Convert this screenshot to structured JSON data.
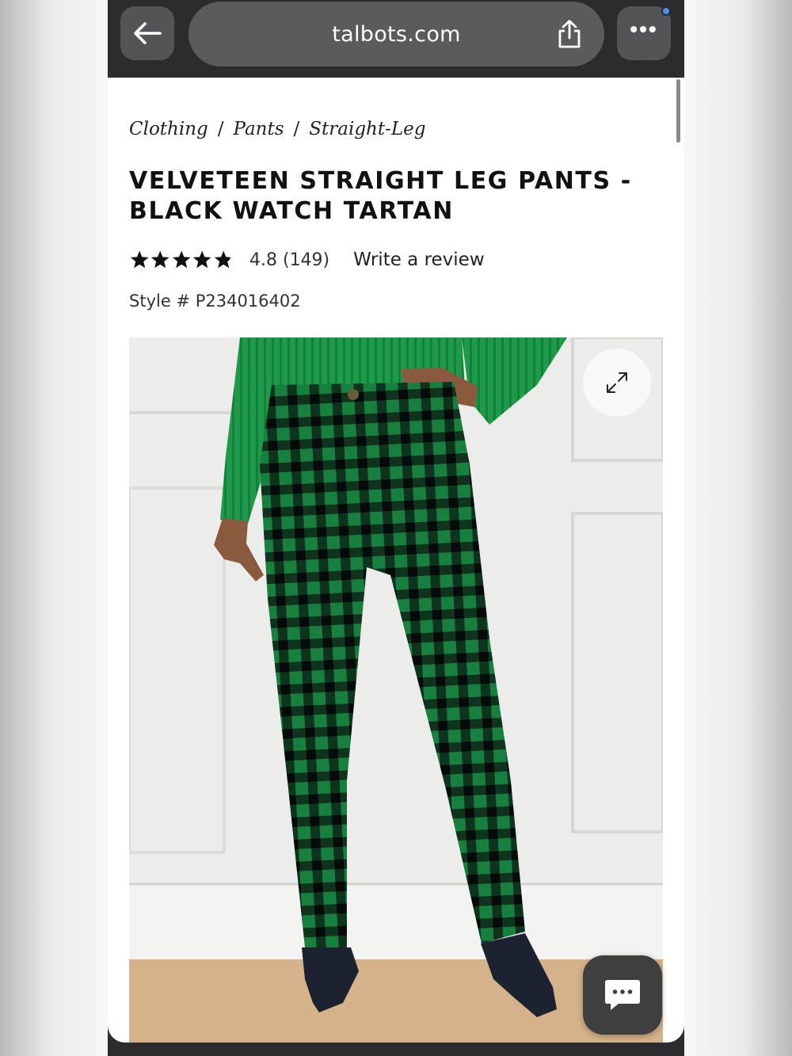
{
  "browser": {
    "url": "talbots.com",
    "back_icon": "arrow-left-icon",
    "share_icon": "share-icon",
    "more_icon": "more-dots-icon",
    "more_label": "•••"
  },
  "breadcrumb": {
    "items": [
      "Clothing",
      "Pants",
      "Straight-Leg"
    ],
    "separator": "/"
  },
  "product": {
    "title": "VELVETEEN STRAIGHT LEG PANTS - BLACK WATCH TARTAN",
    "rating": {
      "stars": 4.8,
      "max": 5,
      "text": "4.8 (149)"
    },
    "write_review": "Write a review",
    "style": "Style # P234016402",
    "image": {
      "description_icon": "product-photo",
      "colors": {
        "tartan_green": "#17803f",
        "tartan_black": "#0b1a12",
        "sweater_green": "#1d9a4a"
      }
    },
    "expand_icon": "expand-icon"
  },
  "chat": {
    "icon": "chat-bubble-icon"
  },
  "colors": {
    "chrome": "#2c2c2e",
    "pill": "#545456",
    "text": "#111111",
    "accent_dot": "#4a90f0"
  }
}
